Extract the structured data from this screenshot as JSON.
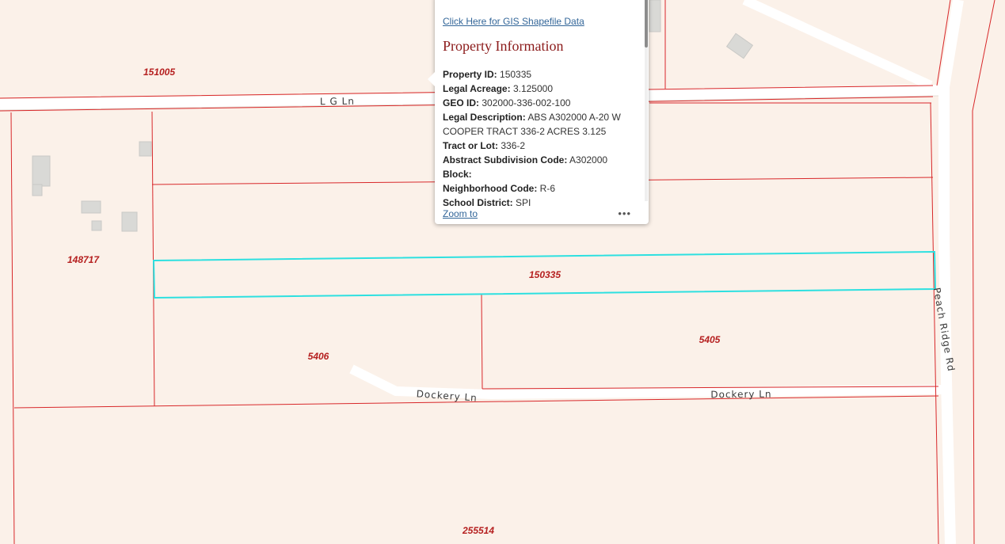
{
  "map": {
    "parcels": [
      {
        "id": "151005"
      },
      {
        "id": "148717"
      },
      {
        "id": "150335"
      },
      {
        "id": "5406"
      },
      {
        "id": "5405"
      },
      {
        "id": "255514"
      }
    ],
    "roads": {
      "lg_ln": "L G Ln",
      "dockery_ln_1": "Dockery Ln",
      "dockery_ln_2": "Dockery Ln",
      "peach_ridge_rd": "Peach Ridge Rd"
    },
    "colors": {
      "background": "#fbf1e9",
      "parcel_line": "#d8282a",
      "selected_parcel": "#2de0e0",
      "road": "#ffffff",
      "building": "#d9d9d6"
    }
  },
  "popup": {
    "gis_link": "Click Here for GIS Shapefile Data",
    "title": "Property Information",
    "fields": [
      {
        "label": "Property ID:",
        "value": "150335"
      },
      {
        "label": "Legal Acreage:",
        "value": "3.125000"
      },
      {
        "label": "GEO ID:",
        "value": "302000-336-002-100"
      },
      {
        "label": "Legal Description:",
        "value": "ABS A302000 A-20 W COOPER TRACT 336-2 ACRES 3.125"
      },
      {
        "label": "Tract or Lot:",
        "value": "336-2"
      },
      {
        "label": "Abstract Subdivision Code:",
        "value": "A302000"
      },
      {
        "label": "Block:",
        "value": ""
      },
      {
        "label": "Neighborhood Code:",
        "value": "R-6"
      },
      {
        "label": "School District:",
        "value": "SPI"
      }
    ],
    "zoom_to": "Zoom to",
    "more_icon": "more-horizontal-icon",
    "more_glyph": "•••"
  }
}
